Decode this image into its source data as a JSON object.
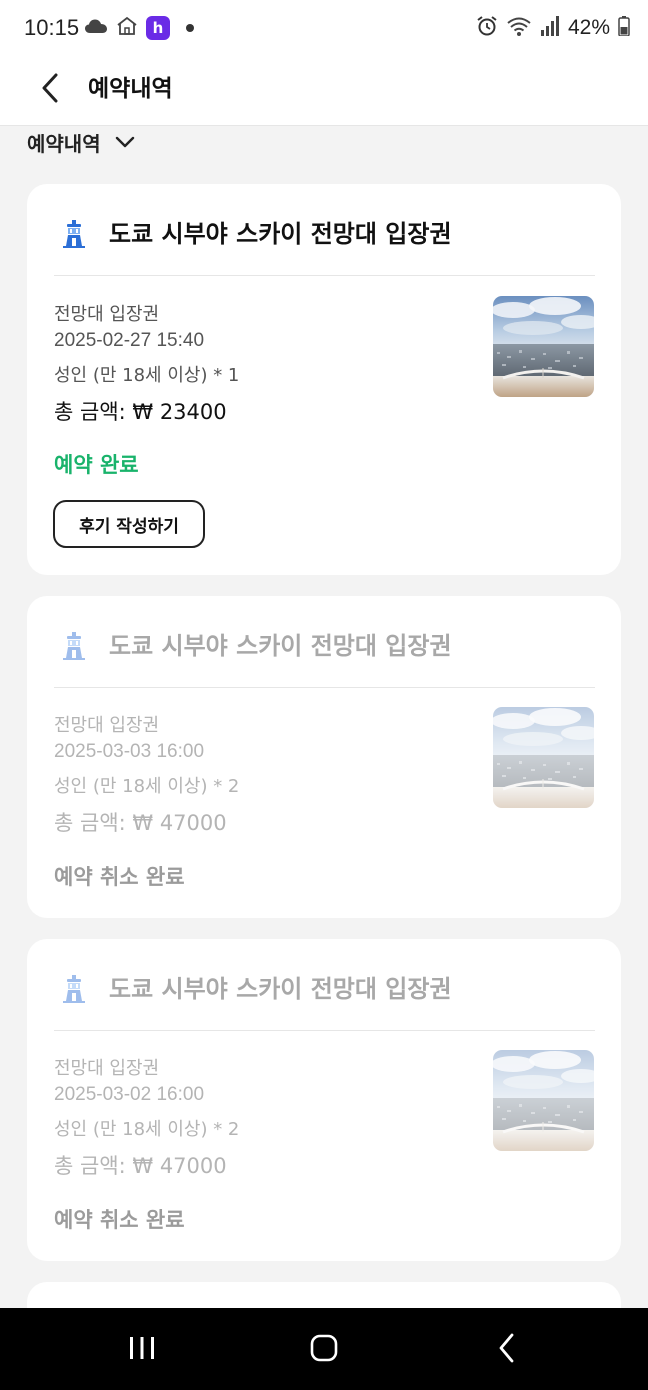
{
  "status_bar": {
    "time": "10:15",
    "battery": "42%",
    "app_badge_letter": "h",
    "left_icons": [
      "cloud-icon",
      "home-icon",
      "app-badge-icon",
      "notification-dot-icon"
    ],
    "right_icons": [
      "alarm-icon",
      "wifi-icon",
      "signal-icon",
      "battery-icon"
    ]
  },
  "header": {
    "title": "예약내역",
    "back_icon": "chevron-left-icon"
  },
  "filter": {
    "label": "예약내역",
    "icon": "chevron-down-icon"
  },
  "colors": {
    "status_complete": "#19b36b",
    "inactive_text": "#b4b4b4",
    "background": "#f3f3f3"
  },
  "reservations": [
    {
      "title": "도쿄 시부야 스카이 전망대 입장권",
      "icon": "observatory-tower-icon",
      "ticket_type": "전망대 입장권",
      "datetime": "2025-02-27 15:40",
      "people": " 성인 (만 18세 이상) * 1",
      "total": "총 금액: ₩ 23400",
      "status": "예약 완료",
      "review_button": "후기 작성하기",
      "active": true
    },
    {
      "title": "도쿄 시부야 스카이 전망대 입장권",
      "icon": "observatory-tower-icon",
      "ticket_type": "전망대 입장권",
      "datetime": "2025-03-03 16:00",
      "people": " 성인 (만 18세 이상) * 2",
      "total": "총 금액: ₩ 47000",
      "status": "예약 취소 완료",
      "active": false
    },
    {
      "title": "도쿄 시부야 스카이 전망대 입장권",
      "icon": "observatory-tower-icon",
      "ticket_type": "전망대 입장권",
      "datetime": "2025-03-02 16:00",
      "people": " 성인 (만 18세 이상) * 2",
      "total": "총 금액: ₩ 47000",
      "status": "예약 취소 완료",
      "active": false
    }
  ],
  "nav_bar": {
    "icons": [
      "recent-apps-icon",
      "home-button-icon",
      "back-nav-icon"
    ]
  }
}
